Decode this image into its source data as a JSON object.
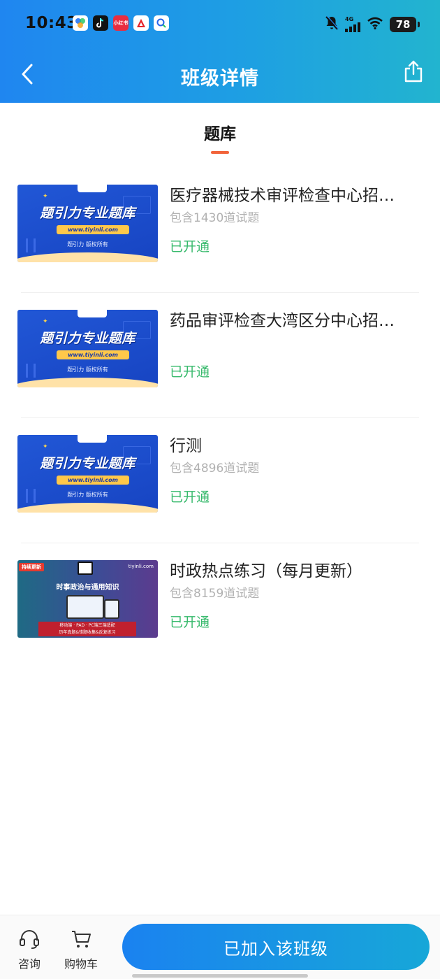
{
  "status_bar": {
    "time": "10:43",
    "network": "4G",
    "battery": "78",
    "app_icons": [
      "photos-app-icon",
      "tiktok-app-icon",
      "xiaohongshu-app-icon",
      "acrobat-app-icon",
      "search-app-icon"
    ],
    "xiaohongshu_label": "小红书"
  },
  "nav": {
    "title": "班级详情"
  },
  "section": {
    "tab_label": "题库",
    "accent_color": "#f2643b"
  },
  "thumbnail": {
    "brand_text": "题引力专业题库",
    "url_text": "www.tiyinli.com",
    "copyright_text": "题引力 版权所有",
    "news_badge": "持续更新",
    "news_site": "tiyinli.com",
    "news_headline": "时事政治与通用知识",
    "news_bar_line1": "移动端 · PAD · PC端三端适配",
    "news_bar_line2": "历年真题&错题收集&反复练习"
  },
  "items": [
    {
      "title": "医疗器械技术审评检查中心招…",
      "count": "包含1430道试题",
      "status": "已开通",
      "thumb_type": "brand"
    },
    {
      "title": "药品审评检查大湾区分中心招…",
      "count": "",
      "status": "已开通",
      "thumb_type": "brand"
    },
    {
      "title": "行测",
      "count": "包含4896道试题",
      "status": "已开通",
      "thumb_type": "brand"
    },
    {
      "title": "时政热点练习（每月更新）",
      "count": "包含8159道试题",
      "status": "已开通",
      "thumb_type": "news"
    }
  ],
  "bottom_bar": {
    "consult_label": "咨询",
    "cart_label": "购物车",
    "join_button_label": "已加入该班级"
  },
  "colors": {
    "header_gradient_start": "#1f86f0",
    "header_gradient_end": "#22b4cf",
    "status_green": "#36b96b",
    "count_gray": "#b1b1b1"
  }
}
